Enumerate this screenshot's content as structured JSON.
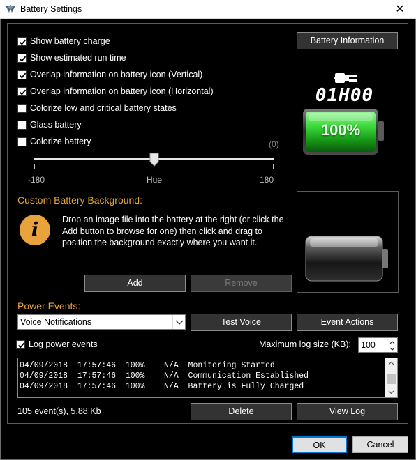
{
  "window": {
    "title": "Battery Settings",
    "close_glyph": "✕"
  },
  "options": {
    "show_battery_charge": {
      "label": "Show battery charge",
      "checked": true
    },
    "show_run_time": {
      "label": "Show estimated run time",
      "checked": true
    },
    "overlap_vertical": {
      "label": "Overlap information on battery icon (Vertical)",
      "checked": true
    },
    "overlap_horizontal": {
      "label": "Overlap information on battery icon (Horizontal)",
      "checked": true
    },
    "colorize_states": {
      "label": "Colorize low and critical battery states",
      "checked": false
    },
    "glass_battery": {
      "label": "Glass battery",
      "checked": false
    },
    "colorize_battery": {
      "label": "Colorize battery",
      "checked": false
    }
  },
  "battery_info_button": "Battery Information",
  "preview": {
    "time": "01H00",
    "percent": "100%",
    "level": 1.0,
    "plug_icon": "plug-icon"
  },
  "hue": {
    "value_text": "(0)",
    "min": "-180",
    "mid": "Hue",
    "max": "180",
    "value": 0,
    "range": [
      -180,
      180
    ]
  },
  "background_section": {
    "title": "Custom Battery Background:",
    "info_icon": "info-icon",
    "info_glyph": "i",
    "text": "Drop an image file into the battery at the right (or click the Add button to browse for one) then click and drag to position the background exactly where you want it.",
    "add_label": "Add",
    "remove_label": "Remove"
  },
  "power_events": {
    "title": "Power Events:",
    "dropdown_value": "Voice Notifications",
    "test_voice_label": "Test Voice",
    "event_actions_label": "Event Actions",
    "log_power_events": {
      "label": "Log power events",
      "checked": true
    },
    "max_log_label": "Maximum log size (KB):",
    "max_log_value": "100",
    "log_rows": [
      "04/09/2018  17:57:46  100%    N/A  Monitoring Started",
      "04/09/2018  17:57:46  100%    N/A  Communication Established",
      "04/09/2018  17:57:46  100%    N/A  Battery is Fully Charged"
    ],
    "summary": "105 event(s), 5,88 Kb",
    "delete_label": "Delete",
    "view_log_label": "View Log"
  },
  "footer": {
    "ok_label": "OK",
    "cancel_label": "Cancel"
  },
  "colors": {
    "accent_orange": "#e8a33c",
    "battery_green": "#3ddb3d",
    "panel_bg": "#000000"
  }
}
